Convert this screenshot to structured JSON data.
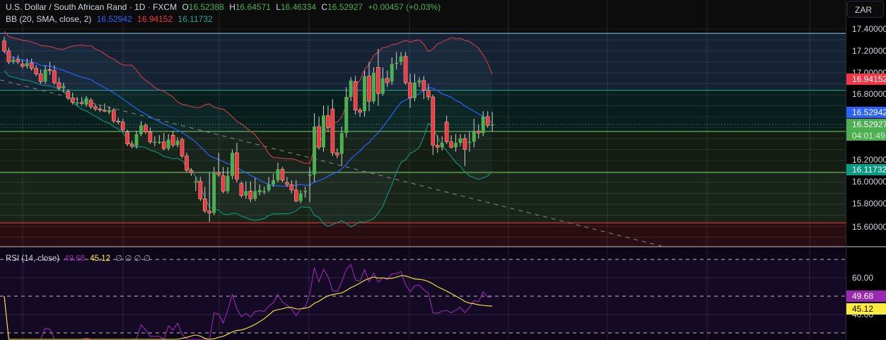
{
  "header": {
    "symbol": "U.S. Dollar / South African Rand · 1D · FXCM",
    "o_label": "O",
    "o": "16.52388",
    "h_label": "H",
    "h": "16.64571",
    "l_label": "L",
    "l": "16.46334",
    "c_label": "C",
    "c": "16.52927",
    "change": "+0.00457 (+0.03%)"
  },
  "bb_legend": {
    "label": "BB (20, SMA, close, 2)",
    "basis": "16.52942",
    "upper": "16.94152",
    "lower": "16.11732"
  },
  "rsi_legend": {
    "label": "RSI (14, close)",
    "rsi": "49.68",
    "ma": "45.12",
    "extra": "∅ ∅ ∅ ∅"
  },
  "currency_button": "ZAR",
  "price_axis": [
    "17.40000",
    "17.20000",
    "17.00000",
    "16.80000",
    "16.20000",
    "16.00000",
    "15.80000",
    "15.60000"
  ],
  "rsi_axis": [
    "60.00",
    "40.00"
  ],
  "tags": {
    "upper": "16.94152",
    "basis": "16.52942",
    "last": "16.52927",
    "countdown": "04:01:49",
    "lower": "16.11732",
    "rsi": "49.68",
    "rsi_ma": "45.12"
  },
  "colors": {
    "up": "#4caf50",
    "down": "#f23645",
    "basis": "#2962ff",
    "upper": "#f23645",
    "lower": "#089981",
    "rsi": "#9c27b0",
    "rsi_ma": "#ffeb3b"
  },
  "chart_data": {
    "type": "candlestick",
    "title": "U.S. Dollar / South African Rand · 1D · FXCM",
    "ylim": [
      15.5,
      17.5
    ],
    "horizontal_levels": [
      17.36,
      16.84,
      16.465,
      16.09,
      15.63
    ],
    "ohlc": [
      [
        17.29,
        17.33,
        17.18,
        17.2
      ],
      [
        17.2,
        17.23,
        17.08,
        17.1
      ],
      [
        17.1,
        17.15,
        17.08,
        17.12
      ],
      [
        17.12,
        17.16,
        17.08,
        17.1
      ],
      [
        17.08,
        17.12,
        17.04,
        17.06
      ],
      [
        17.06,
        17.13,
        17.04,
        17.09
      ],
      [
        17.09,
        17.13,
        17.02,
        17.04
      ],
      [
        17.04,
        17.07,
        16.97,
        16.99
      ],
      [
        16.99,
        17.03,
        16.9,
        16.92
      ],
      [
        16.92,
        17.07,
        16.9,
        17.03
      ],
      [
        17.03,
        17.1,
        16.98,
        17.02
      ],
      [
        17.02,
        17.07,
        16.89,
        16.91
      ],
      [
        16.91,
        16.96,
        16.84,
        16.86
      ],
      [
        16.86,
        16.91,
        16.82,
        16.88
      ],
      [
        16.83,
        16.85,
        16.75,
        16.77
      ],
      [
        16.77,
        16.82,
        16.71,
        16.73
      ],
      [
        16.73,
        16.78,
        16.7,
        16.73
      ],
      [
        16.73,
        16.78,
        16.7,
        16.72
      ],
      [
        16.71,
        16.79,
        16.69,
        16.77
      ],
      [
        16.75,
        16.77,
        16.67,
        16.69
      ],
      [
        16.69,
        16.72,
        16.65,
        16.67
      ],
      [
        16.67,
        16.7,
        16.64,
        16.66
      ],
      [
        16.66,
        16.72,
        16.64,
        16.65
      ],
      [
        16.64,
        16.69,
        16.62,
        16.66
      ],
      [
        16.66,
        16.68,
        16.54,
        16.56
      ],
      [
        16.56,
        16.59,
        16.53,
        16.55
      ],
      [
        16.55,
        16.58,
        16.46,
        16.48
      ],
      [
        16.46,
        16.48,
        16.33,
        16.35
      ],
      [
        16.35,
        16.38,
        16.31,
        16.33
      ],
      [
        16.33,
        16.47,
        16.31,
        16.44
      ],
      [
        16.44,
        16.56,
        16.42,
        16.52
      ],
      [
        16.52,
        16.54,
        16.44,
        16.46
      ],
      [
        16.46,
        16.5,
        16.35,
        16.37
      ],
      [
        16.37,
        16.42,
        16.33,
        16.37
      ],
      [
        16.37,
        16.43,
        16.35,
        16.37
      ],
      [
        16.37,
        16.45,
        16.29,
        16.31
      ],
      [
        16.31,
        16.44,
        16.29,
        16.39
      ],
      [
        16.43,
        16.47,
        16.32,
        16.34
      ],
      [
        16.34,
        16.41,
        16.32,
        16.38
      ],
      [
        16.39,
        16.41,
        16.22,
        16.24
      ],
      [
        16.24,
        16.27,
        16.09,
        16.11
      ],
      [
        16.11,
        16.13,
        16.06,
        16.09
      ],
      [
        16.01,
        16.05,
        15.92,
        16.01
      ],
      [
        16.01,
        16.05,
        15.83,
        15.85
      ],
      [
        15.85,
        15.96,
        15.72,
        15.74
      ],
      [
        15.74,
        16.09,
        15.64,
        15.72
      ],
      [
        15.72,
        16.14,
        15.7,
        16.09
      ],
      [
        16.09,
        16.27,
        16.05,
        16.07
      ],
      [
        16.06,
        16.14,
        15.9,
        15.92
      ],
      [
        15.92,
        16.14,
        15.9,
        16.06
      ],
      [
        16.06,
        16.3,
        16.03,
        16.27
      ],
      [
        16.27,
        16.36,
        16.0,
        16.03
      ],
      [
        15.99,
        16.01,
        15.86,
        15.88
      ],
      [
        15.88,
        16.01,
        15.85,
        15.92
      ],
      [
        15.92,
        16.01,
        15.82,
        15.85
      ],
      [
        15.85,
        16.04,
        15.83,
        15.92
      ],
      [
        15.91,
        15.98,
        15.88,
        15.93
      ],
      [
        15.92,
        15.96,
        15.89,
        15.92
      ],
      [
        15.93,
        16.05,
        15.91,
        15.98
      ],
      [
        15.98,
        16.08,
        15.96,
        16.02
      ],
      [
        16.02,
        16.18,
        16.0,
        16.12
      ],
      [
        16.12,
        16.14,
        16.0,
        16.02
      ],
      [
        16.0,
        16.05,
        15.96,
        15.98
      ],
      [
        15.98,
        16.02,
        15.9,
        15.93
      ],
      [
        15.93,
        16.02,
        15.82,
        15.83
      ],
      [
        15.83,
        15.93,
        15.81,
        15.9
      ],
      [
        15.91,
        15.96,
        15.86,
        15.92
      ],
      [
        16.07,
        16.14,
        15.82,
        16.07
      ],
      [
        16.07,
        16.63,
        16.0,
        16.51
      ],
      [
        16.51,
        16.6,
        16.3,
        16.32
      ],
      [
        16.32,
        16.7,
        16.28,
        16.61
      ],
      [
        16.61,
        16.7,
        16.46,
        16.5
      ],
      [
        16.67,
        16.76,
        16.24,
        16.27
      ],
      [
        16.27,
        16.31,
        16.22,
        16.25
      ],
      [
        16.26,
        16.51,
        16.15,
        16.45
      ],
      [
        16.45,
        16.87,
        16.41,
        16.78
      ],
      [
        16.78,
        16.96,
        16.74,
        16.93
      ],
      [
        16.92,
        16.97,
        16.62,
        16.66
      ],
      [
        16.66,
        16.68,
        16.6,
        16.64
      ],
      [
        16.65,
        17.02,
        16.6,
        16.97
      ],
      [
        16.97,
        17.1,
        16.65,
        16.74
      ],
      [
        16.74,
        17.05,
        16.72,
        17.0
      ],
      [
        17.05,
        17.22,
        16.7,
        16.81
      ],
      [
        16.81,
        17.05,
        16.79,
        16.95
      ],
      [
        16.95,
        17.02,
        16.87,
        16.91
      ],
      [
        16.92,
        17.14,
        16.89,
        17.08
      ],
      [
        17.08,
        17.19,
        17.03,
        17.09
      ],
      [
        17.1,
        17.19,
        17.07,
        17.15
      ],
      [
        17.15,
        17.19,
        16.89,
        16.91
      ],
      [
        16.91,
        16.99,
        16.68,
        16.77
      ],
      [
        16.77,
        16.99,
        16.74,
        16.91
      ],
      [
        16.91,
        16.96,
        16.87,
        16.93
      ],
      [
        16.93,
        16.97,
        16.76,
        16.84
      ],
      [
        16.84,
        16.9,
        16.75,
        16.78
      ],
      [
        16.78,
        16.8,
        16.25,
        16.34
      ],
      [
        16.34,
        16.43,
        16.27,
        16.32
      ],
      [
        16.32,
        16.42,
        16.29,
        16.36
      ],
      [
        16.55,
        16.61,
        16.35,
        16.37
      ],
      [
        16.37,
        16.43,
        16.31,
        16.32
      ],
      [
        16.32,
        16.44,
        16.28,
        16.36
      ],
      [
        16.36,
        16.44,
        16.33,
        16.4
      ],
      [
        16.4,
        16.44,
        16.15,
        16.3
      ],
      [
        16.37,
        16.46,
        16.28,
        16.37
      ],
      [
        16.37,
        16.58,
        16.32,
        16.47
      ],
      [
        16.47,
        16.53,
        16.4,
        16.45
      ],
      [
        16.45,
        16.65,
        16.42,
        16.6
      ],
      [
        16.6,
        16.65,
        16.5,
        16.52
      ],
      [
        16.52388,
        16.64571,
        16.46334,
        16.52927
      ]
    ],
    "indicators": [
      "BB (20, SMA, close, 2)",
      "RSI (14, close)"
    ],
    "rsi_levels": [
      70,
      50,
      30
    ],
    "rsi_ylim": [
      25,
      75
    ]
  }
}
